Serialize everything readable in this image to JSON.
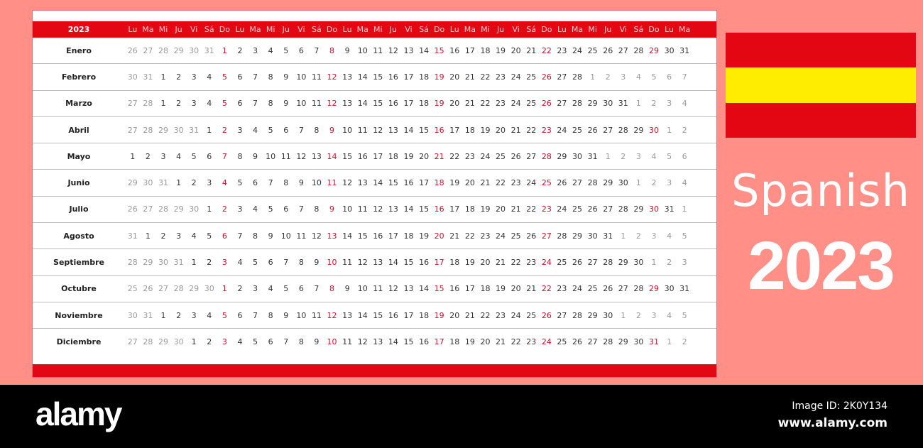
{
  "calendar": {
    "year": "2023",
    "weekday_headers": [
      "Lu",
      "Ma",
      "Mi",
      "Ju",
      "Vi",
      "Sá",
      "Do",
      "Lu",
      "Ma",
      "Mi",
      "Ju",
      "Vi",
      "Sá",
      "Do",
      "Lu",
      "Ma",
      "Mi",
      "Ju",
      "Vi",
      "Sá",
      "Do",
      "Lu",
      "Ma",
      "Mi",
      "Ju",
      "Vi",
      "Sá",
      "Do",
      "Lu",
      "Ma",
      "Mi",
      "Ju",
      "Vi",
      "Sá",
      "Do",
      "Lu",
      "Ma"
    ],
    "months": [
      {
        "name": "Enero",
        "days": [
          26,
          27,
          28,
          29,
          30,
          31,
          1,
          2,
          3,
          4,
          5,
          6,
          7,
          8,
          9,
          10,
          11,
          12,
          13,
          14,
          15,
          16,
          17,
          18,
          19,
          20,
          21,
          22,
          23,
          24,
          25,
          26,
          27,
          28,
          29,
          30,
          31
        ],
        "lead_other": 6,
        "trail_other": 0
      },
      {
        "name": "Febrero",
        "days": [
          30,
          31,
          1,
          2,
          3,
          4,
          5,
          6,
          7,
          8,
          9,
          10,
          11,
          12,
          13,
          14,
          15,
          16,
          17,
          18,
          19,
          20,
          21,
          22,
          23,
          24,
          25,
          26,
          27,
          28,
          1,
          2,
          3,
          4,
          5,
          6,
          7
        ],
        "lead_other": 2,
        "trail_other": 7
      },
      {
        "name": "Marzo",
        "days": [
          27,
          28,
          1,
          2,
          3,
          4,
          5,
          6,
          7,
          8,
          9,
          10,
          11,
          12,
          13,
          14,
          15,
          16,
          17,
          18,
          19,
          20,
          21,
          22,
          23,
          24,
          25,
          26,
          27,
          28,
          29,
          30,
          31,
          1,
          2,
          3,
          4
        ],
        "lead_other": 2,
        "trail_other": 4
      },
      {
        "name": "Abril",
        "days": [
          27,
          28,
          29,
          30,
          31,
          1,
          2,
          3,
          4,
          5,
          6,
          7,
          8,
          9,
          10,
          11,
          12,
          13,
          14,
          15,
          16,
          17,
          18,
          19,
          20,
          21,
          22,
          23,
          24,
          25,
          26,
          27,
          28,
          29,
          30,
          1,
          2
        ],
        "lead_other": 5,
        "trail_other": 2
      },
      {
        "name": "Mayo",
        "days": [
          1,
          2,
          3,
          4,
          5,
          6,
          7,
          8,
          9,
          10,
          11,
          12,
          13,
          14,
          15,
          16,
          17,
          18,
          19,
          20,
          21,
          22,
          23,
          24,
          25,
          26,
          27,
          28,
          29,
          30,
          31,
          1,
          2,
          3,
          4,
          5,
          6
        ],
        "lead_other": 0,
        "trail_other": 6
      },
      {
        "name": "Junio",
        "days": [
          29,
          30,
          31,
          1,
          2,
          3,
          4,
          5,
          6,
          7,
          8,
          9,
          10,
          11,
          12,
          13,
          14,
          15,
          16,
          17,
          18,
          19,
          20,
          21,
          22,
          23,
          24,
          25,
          26,
          27,
          28,
          29,
          30,
          1,
          2,
          3,
          4
        ],
        "lead_other": 3,
        "trail_other": 4
      },
      {
        "name": "Julio",
        "days": [
          26,
          27,
          28,
          29,
          30,
          1,
          2,
          3,
          4,
          5,
          6,
          7,
          8,
          9,
          10,
          11,
          12,
          13,
          14,
          15,
          16,
          17,
          18,
          19,
          20,
          21,
          22,
          23,
          24,
          25,
          26,
          27,
          28,
          29,
          30,
          31,
          1
        ],
        "lead_other": 5,
        "trail_other": 1
      },
      {
        "name": "Agosto",
        "days": [
          31,
          1,
          2,
          3,
          4,
          5,
          6,
          7,
          8,
          9,
          10,
          11,
          12,
          13,
          14,
          15,
          16,
          17,
          18,
          19,
          20,
          21,
          22,
          23,
          24,
          25,
          26,
          27,
          28,
          29,
          30,
          31,
          1,
          2,
          3,
          4,
          5
        ],
        "lead_other": 1,
        "trail_other": 5
      },
      {
        "name": "Septiembre",
        "days": [
          28,
          29,
          30,
          31,
          1,
          2,
          3,
          4,
          5,
          6,
          7,
          8,
          9,
          10,
          11,
          12,
          13,
          14,
          15,
          16,
          17,
          18,
          19,
          20,
          21,
          22,
          23,
          24,
          25,
          26,
          27,
          28,
          29,
          30,
          1,
          2,
          3
        ],
        "lead_other": 4,
        "trail_other": 3
      },
      {
        "name": "Octubre",
        "days": [
          25,
          26,
          27,
          28,
          29,
          30,
          1,
          2,
          3,
          4,
          5,
          6,
          7,
          8,
          9,
          10,
          11,
          12,
          13,
          14,
          15,
          16,
          17,
          18,
          19,
          20,
          21,
          22,
          23,
          24,
          25,
          26,
          27,
          28,
          29,
          30,
          31
        ],
        "lead_other": 6,
        "trail_other": 0
      },
      {
        "name": "Noviembre",
        "days": [
          30,
          31,
          1,
          2,
          3,
          4,
          5,
          6,
          7,
          8,
          9,
          10,
          11,
          12,
          13,
          14,
          15,
          16,
          17,
          18,
          19,
          20,
          21,
          22,
          23,
          24,
          25,
          26,
          27,
          28,
          29,
          30,
          1,
          2,
          3,
          4,
          5
        ],
        "lead_other": 2,
        "trail_other": 5
      },
      {
        "name": "Diciembre",
        "days": [
          27,
          28,
          29,
          30,
          1,
          2,
          3,
          4,
          5,
          6,
          7,
          8,
          9,
          10,
          11,
          12,
          13,
          14,
          15,
          16,
          17,
          18,
          19,
          20,
          21,
          22,
          23,
          24,
          25,
          26,
          27,
          28,
          29,
          30,
          31,
          1,
          2
        ],
        "lead_other": 4,
        "trail_other": 2
      }
    ]
  },
  "side_panel": {
    "flag": "spain-flag",
    "language_label": "Spanish",
    "year_label": "2023"
  },
  "footer": {
    "brand": "alamy",
    "image_id": "Image ID: 2K0Y134",
    "url": "www.alamy.com"
  },
  "colors": {
    "background": "#ff8f87",
    "header_red": "#e30613",
    "sunday_red": "#d0112b",
    "flag_yellow": "#ffed00",
    "other_month_gray": "#9a9a9a"
  }
}
